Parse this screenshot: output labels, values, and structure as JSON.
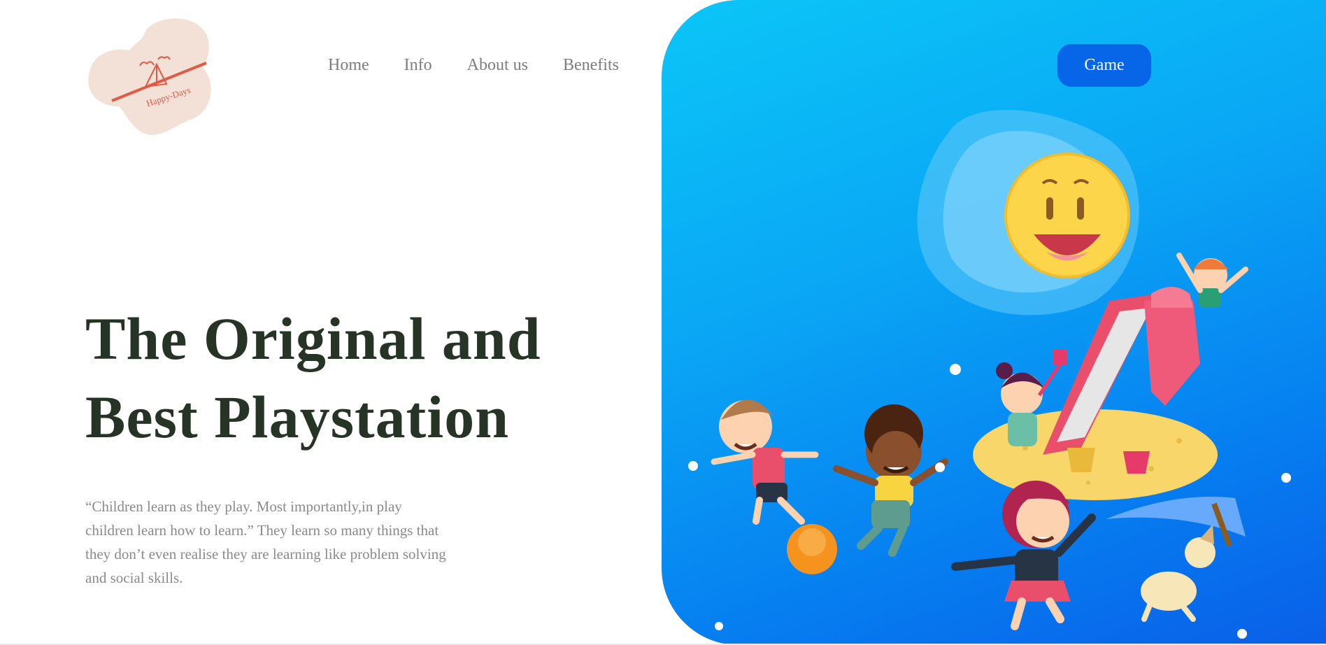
{
  "logo": {
    "text": "Happy-Days",
    "icon": "tent-cloud-icon"
  },
  "nav": {
    "items": [
      {
        "label": "Home"
      },
      {
        "label": "Info"
      },
      {
        "label": "About us"
      },
      {
        "label": "Benefits"
      }
    ]
  },
  "game_button": {
    "label": "Game"
  },
  "hero": {
    "headline_line1": "The Original and",
    "headline_line2": "Best Playstation",
    "quote_line1": "“Children learn as they play. Most importantly,in play",
    "quote_line2": "children learn how to learn.” They learn so many things that",
    "quote_line3": "they don’t even realise they are learning like problem solving",
    "quote_line4": "and social skills."
  },
  "colors": {
    "brand_blue": "#0766e8",
    "headline": "#263425",
    "logo_blob": "#f3e0d6",
    "logo_accent": "#e05a44"
  },
  "illustration": {
    "icon": "kids-playground-illustration"
  }
}
